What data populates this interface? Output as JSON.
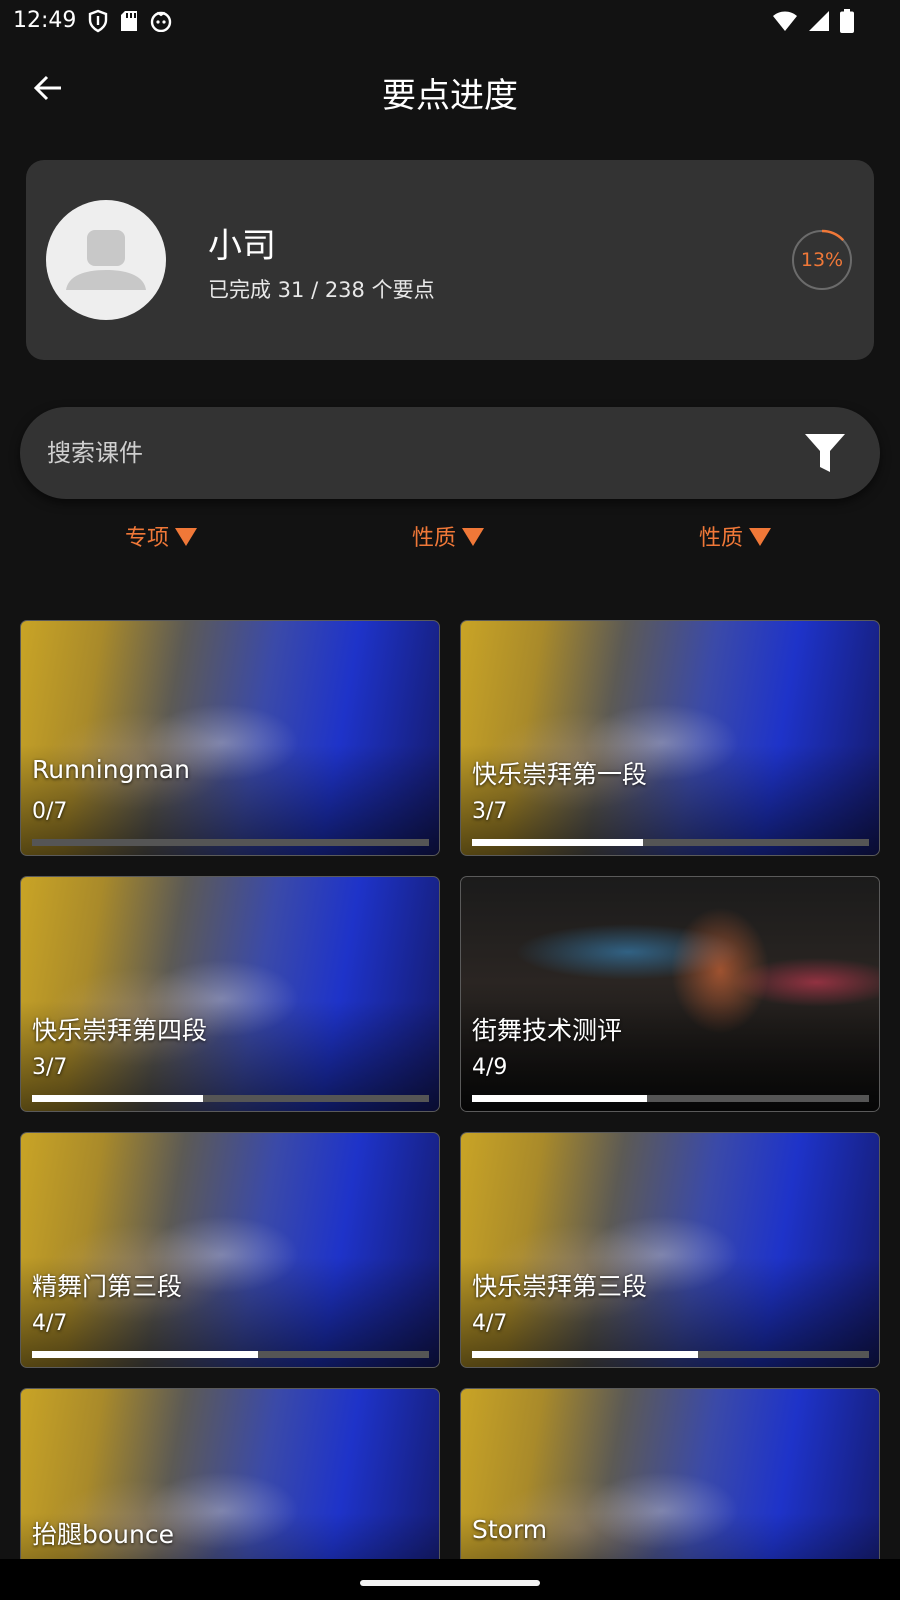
{
  "status_bar": {
    "time": "12:49",
    "left_icons": [
      "shield-icon",
      "sd-card-icon",
      "face-icon"
    ],
    "right_icons": [
      "wifi-icon",
      "signal-icon",
      "battery-icon"
    ]
  },
  "header": {
    "title": "要点进度",
    "back_icon": "arrow-left-icon"
  },
  "profile": {
    "name": "小司",
    "progress_text": "已完成 31 / 238 个要点",
    "percent_label": "13%",
    "percent_value": 0.13,
    "accent_color": "#f07838"
  },
  "search": {
    "placeholder": "搜索课件",
    "filter_icon": "funnel-icon"
  },
  "filters": [
    {
      "label": "专项"
    },
    {
      "label": "性质"
    },
    {
      "label": "性质"
    }
  ],
  "courses": [
    {
      "title": "Runningman",
      "count": "0/7",
      "progress": 0.0,
      "thumb": "dancers-duo"
    },
    {
      "title": "快乐崇拜第一段",
      "count": "3/7",
      "progress": 0.43,
      "thumb": "dancers-duo"
    },
    {
      "title": "快乐崇拜第四段",
      "count": "3/7",
      "progress": 0.43,
      "thumb": "dancers-duo"
    },
    {
      "title": "街舞技术测评",
      "count": "4/9",
      "progress": 0.44,
      "thumb": "hoodie-dancer"
    },
    {
      "title": "精舞门第三段",
      "count": "4/7",
      "progress": 0.57,
      "thumb": "dancers-duo"
    },
    {
      "title": "快乐崇拜第三段",
      "count": "4/7",
      "progress": 0.57,
      "thumb": "dancers-duo"
    },
    {
      "title": "抬腿bounce",
      "count": "",
      "progress": 0.0,
      "thumb": "dancers-duo"
    },
    {
      "title": "Storm",
      "count": "",
      "progress": 0.0,
      "thumb": "dancers-duo"
    }
  ]
}
